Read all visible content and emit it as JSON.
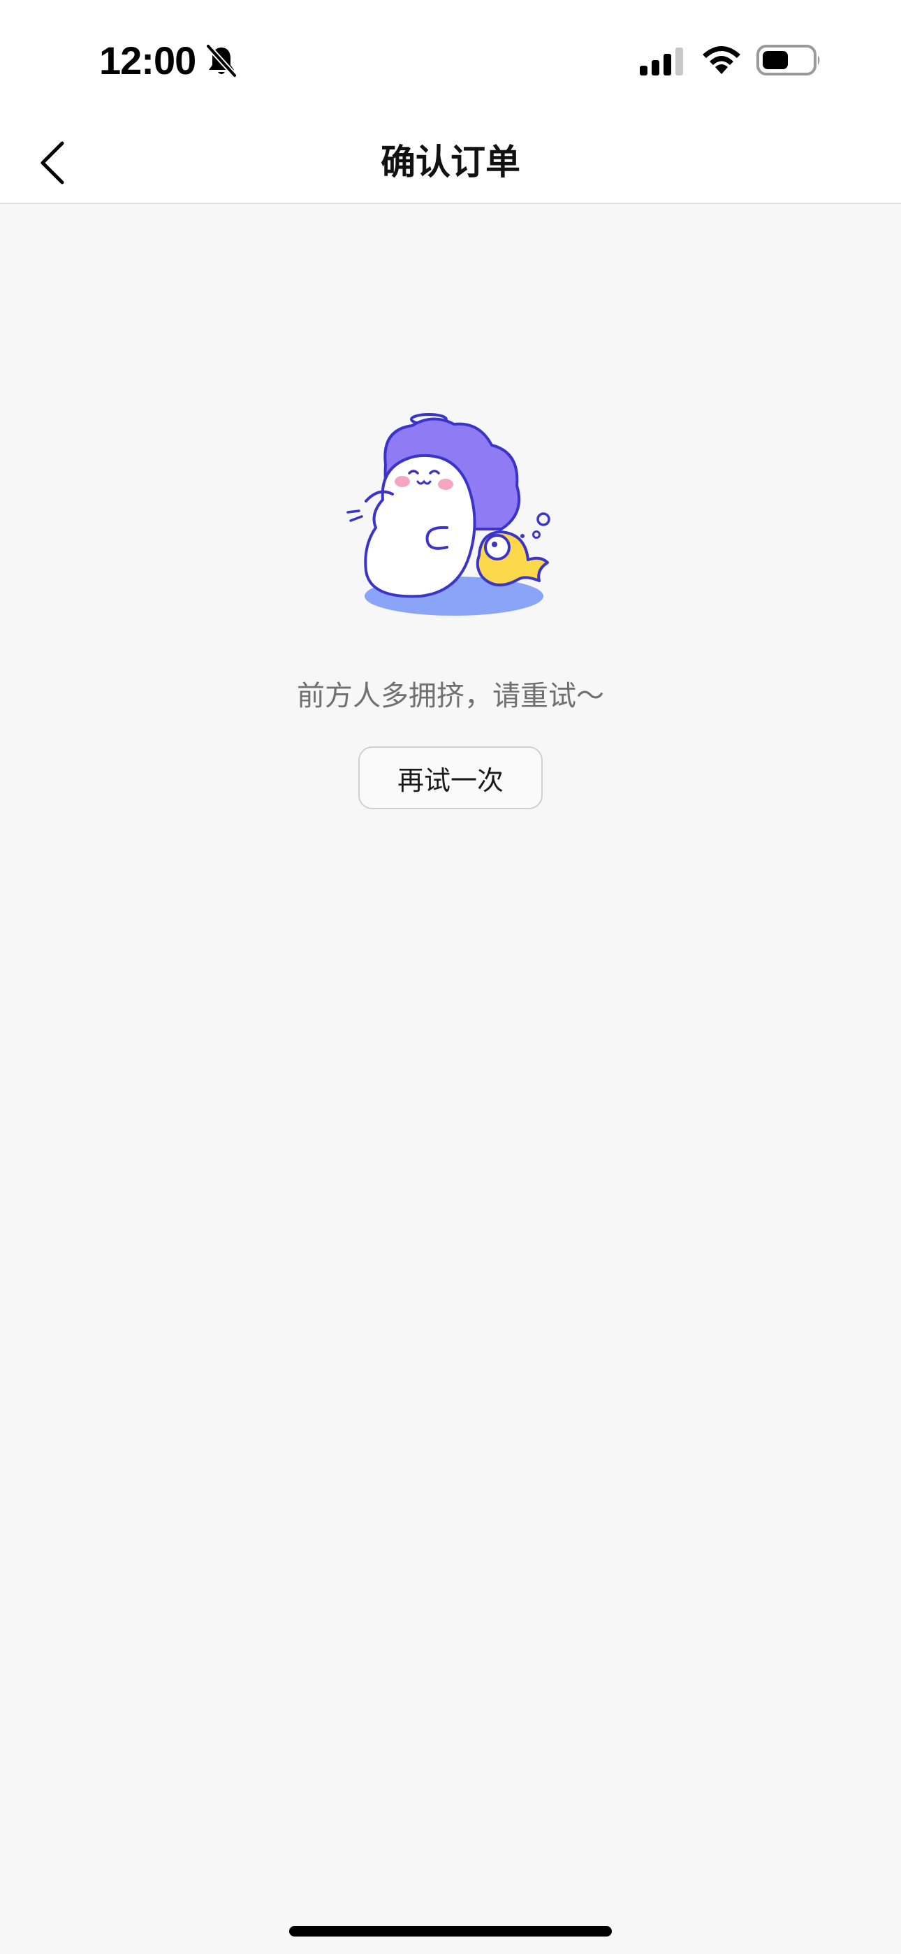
{
  "status_bar": {
    "time": "12:00",
    "bell_icon": "bell-slash-icon",
    "signal_icon": "cellular-signal-icon",
    "wifi_icon": "wifi-icon",
    "battery_icon": "battery-icon"
  },
  "nav": {
    "back_icon": "chevron-left-icon",
    "title": "确认订单"
  },
  "empty_state": {
    "illustration": "busy-ghost-illustration",
    "message": "前方人多拥挤，请重试～",
    "retry_label": "再试一次"
  },
  "colors": {
    "background": "#f7f7f7",
    "nav_background": "#ffffff",
    "accent_purple": "#8f7cf4",
    "outline_blue": "#3b34c8",
    "fish_yellow": "#fcd94a",
    "shadow_blue": "#8aa4f7"
  }
}
